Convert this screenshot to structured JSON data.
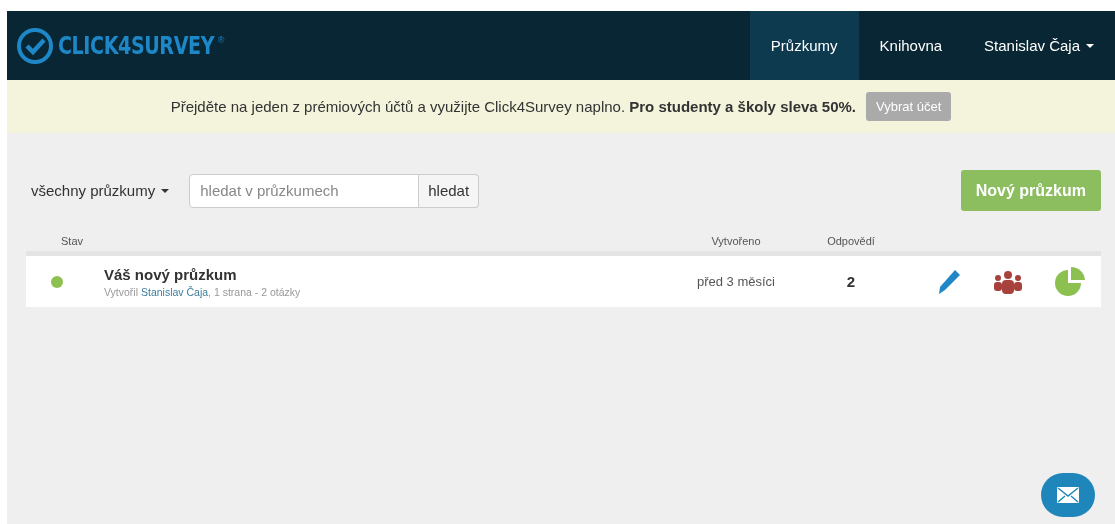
{
  "navbar": {
    "logo": "CLICK4SURVEY",
    "logo_mark": "®",
    "items": [
      {
        "label": "Průzkumy",
        "selected": true
      },
      {
        "label": "Knihovna",
        "selected": false
      }
    ],
    "user": "Stanislav Čaja"
  },
  "banner": {
    "text": "Přejděte na jeden z prémiových účtů a využijte Click4Survey naplno. **Pro studenty a školy sleva 50%.**",
    "button": "Vybrat účet"
  },
  "toolbar": {
    "filter": "všechny průzkumy",
    "search": {
      "placeholder": "hledat v průzkumech"
    },
    "search_button": "hledat",
    "new_button": "Nový průzkum"
  },
  "table": {
    "columns": [
      "Stav",
      "Vytvořeno",
      "Odpovědí"
    ],
    "rows": [
      {
        "color": "#8cc152",
        "title": "Váš nový průzkum",
        "meta_prefix": "Vytvořil",
        "author": "Stanislav Čaja",
        "meta_suffix": ", 1 strana - 2 otázky",
        "created": "před 3 měsíci",
        "responses": "2"
      }
    ]
  }
}
